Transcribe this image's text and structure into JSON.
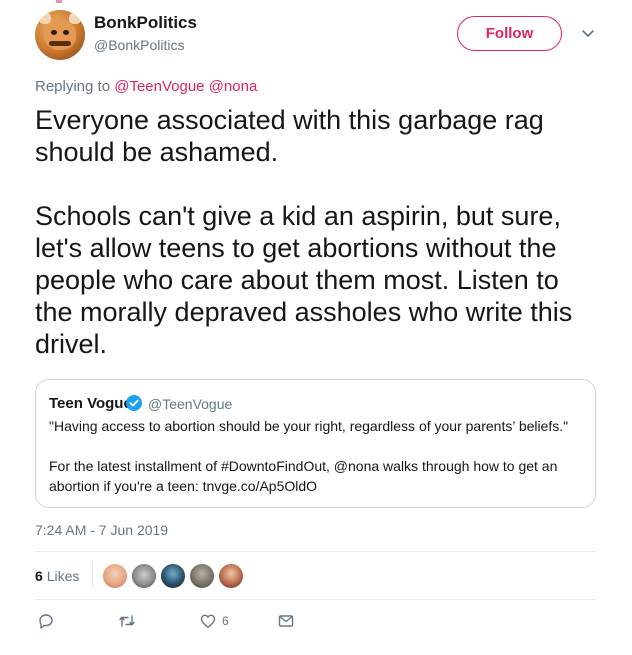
{
  "author": {
    "name": "BonkPolitics",
    "handle": "@BonkPolitics"
  },
  "follow_label": "Follow",
  "reply_to": {
    "prefix": "Replying to",
    "mentions": "@TeenVogue @nona"
  },
  "tweet_text": "Everyone associated with this garbage rag\nshould be ashamed.\n\nSchools can't give a kid an aspirin, but sure,\nlet's allow teens to get abortions without the\npeople who care about them most. Listen to\nthe morally depraved assholes who write this\ndrivel.",
  "quoted": {
    "name": "Teen Vogue",
    "handle": "@TeenVogue",
    "line1": "\"Having access to abortion should be your right, regardless of your parents’ beliefs.\"",
    "line2": "For the latest installment of #DowntoFindOut, @nona walks through how to get an",
    "line3": "abortion if you're a teen: tnvge.co/Ap5OldO"
  },
  "timestamp": "7:24 AM - 7 Jun 2019",
  "likes": {
    "count": "6",
    "label": "Likes"
  },
  "actions": {
    "like_count": "6"
  },
  "colors": {
    "accent": "#e0245e",
    "verified": "#1da1f2",
    "muted": "#657786"
  },
  "icons": {
    "reply": "reply-icon",
    "retweet": "retweet-icon",
    "like": "heart-icon",
    "dm": "envelope-icon",
    "caret": "chevron-down-icon",
    "verified": "verified-badge-icon"
  }
}
